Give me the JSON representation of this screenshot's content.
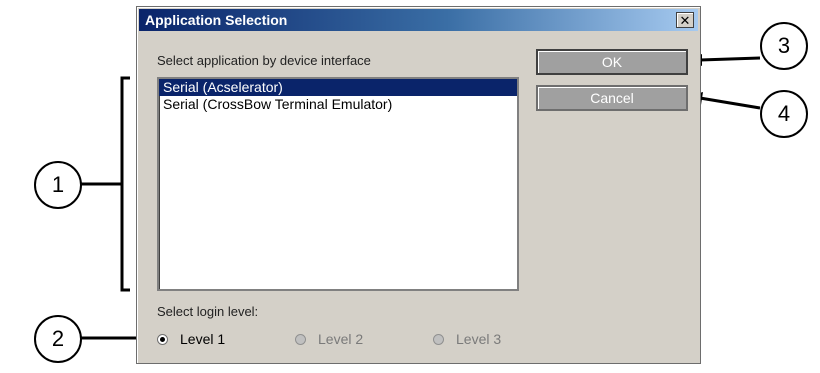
{
  "dialog": {
    "title": "Application Selection",
    "close_glyph": "✕",
    "prompt": "Select application by device interface",
    "list_items": [
      {
        "label": "Serial (Acselerator)",
        "selected": true
      },
      {
        "label": "Serial (CrossBow Terminal Emulator)",
        "selected": false
      }
    ],
    "ok_label": "OK",
    "cancel_label": "Cancel",
    "login_label": "Select login level:",
    "levels": [
      {
        "label": "Level 1",
        "checked": true,
        "enabled": true
      },
      {
        "label": "Level 2",
        "checked": false,
        "enabled": false
      },
      {
        "label": "Level 3",
        "checked": false,
        "enabled": false
      }
    ]
  },
  "callouts": [
    "1",
    "2",
    "3",
    "4"
  ],
  "colors": {
    "title_bar": "#0a246a",
    "selection": "#0a246a",
    "dialog_bg": "#d4d0c8"
  }
}
